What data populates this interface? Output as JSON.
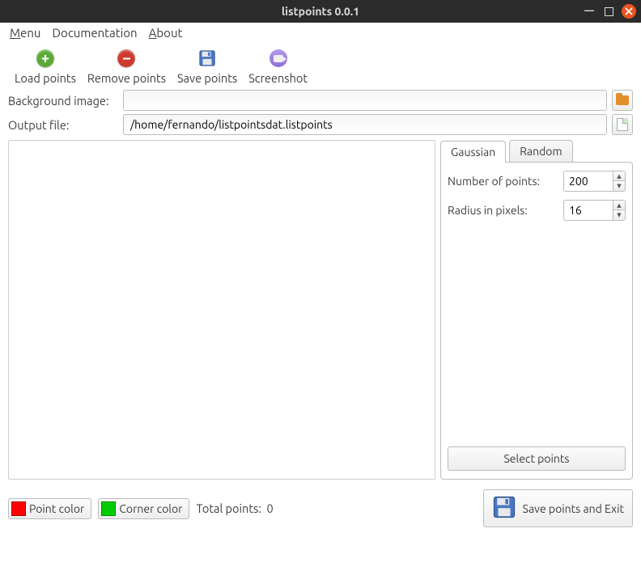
{
  "window": {
    "title": "listpoints 0.0.1"
  },
  "menubar": {
    "menu": "Menu",
    "documentation": "Documentation",
    "about": "About"
  },
  "toolbar": {
    "load": "Load points",
    "remove": "Remove points",
    "save": "Save points",
    "screenshot": "Screenshot"
  },
  "form": {
    "bg_label": "Background image:",
    "bg_value": "",
    "out_label": "Output file:",
    "out_value": "/home/fernando/listpointsdat.listpoints"
  },
  "tabs": {
    "gaussian": "Gaussian",
    "random": "Random"
  },
  "params": {
    "num_label": "Number of points:",
    "num_value": "200",
    "radius_label": "Radius in pixels:",
    "radius_value": "16"
  },
  "buttons": {
    "select_points": "Select points",
    "save_exit": "Save points and Exit"
  },
  "footer": {
    "point_color_label": "Point color",
    "point_color": "#ff0000",
    "corner_color_label": "Corner color",
    "corner_color": "#00cc00",
    "total_label": "Total points:",
    "total_value": "0"
  }
}
